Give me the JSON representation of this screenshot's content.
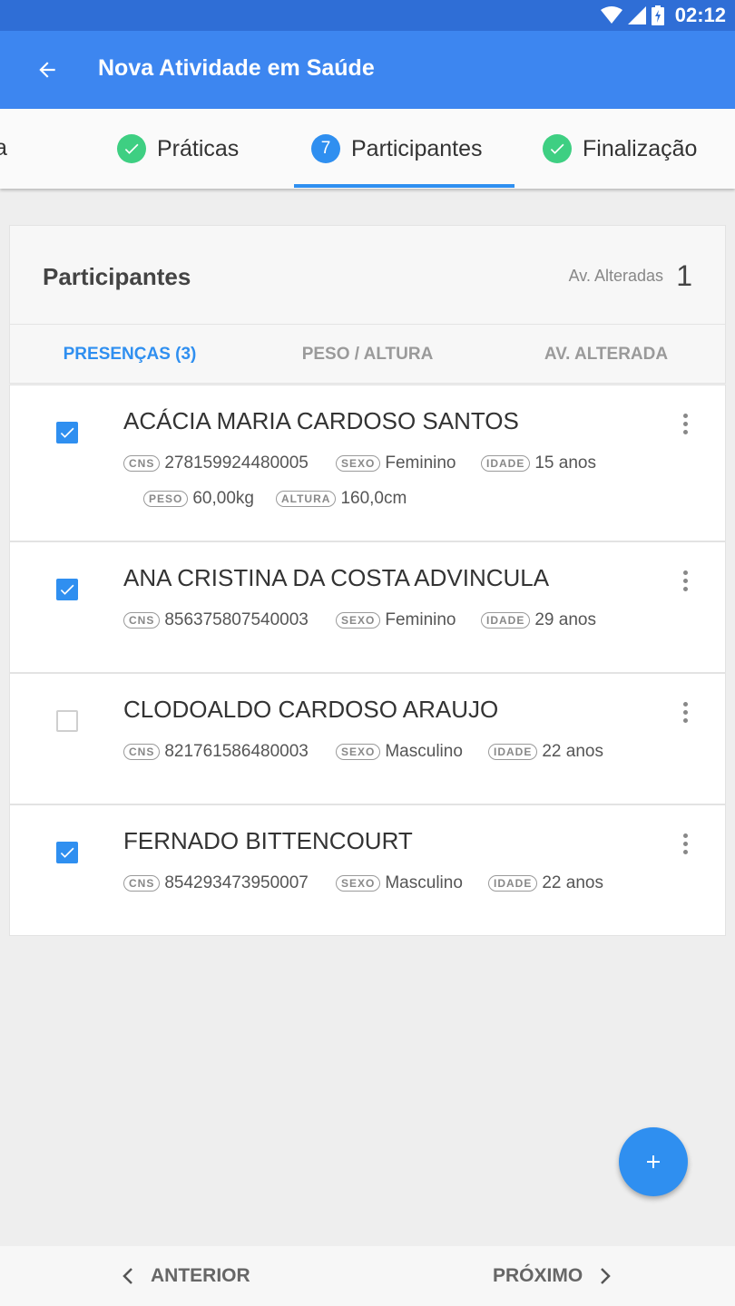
{
  "status_bar": {
    "time": "02:12"
  },
  "app_bar": {
    "title": "Nova Atividade em Saúde"
  },
  "stepper": {
    "partial_label": "a",
    "steps": [
      {
        "label": "Práticas",
        "state": "done"
      },
      {
        "label": "Participantes",
        "state": "active",
        "number": "7"
      },
      {
        "label": "Finalização",
        "state": "done"
      }
    ]
  },
  "card": {
    "title": "Participantes",
    "altered_label": "Av. Alteradas",
    "altered_count": "1"
  },
  "tabs": [
    {
      "label": "PRESENÇAS (3)",
      "active": true
    },
    {
      "label": "PESO / ALTURA",
      "active": false
    },
    {
      "label": "AV. ALTERADA",
      "active": false
    }
  ],
  "labels": {
    "cns": "CNS",
    "sexo": "SEXO",
    "idade": "IDADE",
    "peso": "PESO",
    "altura": "ALTURA"
  },
  "participants": [
    {
      "name": "ACÁCIA MARIA CARDOSO SANTOS",
      "checked": true,
      "cns": "278159924480005",
      "sexo": "Feminino",
      "idade": "15 anos",
      "peso": "60,00kg",
      "altura": "160,0cm"
    },
    {
      "name": "ANA CRISTINA DA COSTA ADVINCULA",
      "checked": true,
      "cns": "856375807540003",
      "sexo": "Feminino",
      "idade": "29 anos"
    },
    {
      "name": "CLODOALDO CARDOSO ARAUJO",
      "checked": false,
      "cns": "821761586480003",
      "sexo": "Masculino",
      "idade": "22 anos"
    },
    {
      "name": "FERNADO BITTENCOURT",
      "checked": true,
      "cns": "854293473950007",
      "sexo": "Masculino",
      "idade": "22 anos"
    }
  ],
  "footer": {
    "prev_label": "ANTERIOR",
    "next_label": "PRÓXIMO"
  },
  "colors": {
    "primary": "#3d86f0",
    "status_bar": "#2f6ed6",
    "accent": "#2f8ff0",
    "done": "#3ecf82"
  }
}
